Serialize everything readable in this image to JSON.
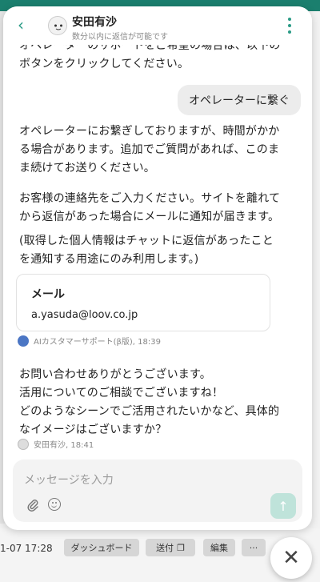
{
  "header": {
    "name": "安田有沙",
    "subtitle": "数分以内に返信が可能です"
  },
  "messages": {
    "partial_top_line1": "オペレーターのサポートをご希望の場合は、以下の",
    "partial_top_line2": "ボタンをクリックしてください。",
    "user_message": "オペレーターに繋ぐ",
    "bot_wait_line1": "オペレーターにお繋ぎしておりますが、時間がかか",
    "bot_wait_line2": "る場合があります。追加でご質問があれば、このま",
    "bot_wait_line3": "ま続けてお送りください。",
    "contact_line1": "お客様の連絡先をご入力ください。サイトを離れて",
    "contact_line2": "から返信があった場合にメールに通知が届きます。",
    "privacy_line1": "(取得した個人情報はチャットに返信があったこと",
    "privacy_line2": "を通知する用途にのみ利用します。)",
    "email_card": {
      "title": "メール",
      "value": "a.yasuda@loov.co.jp"
    },
    "ai_meta": "AIカスタマーサポート(β版), 18:39",
    "agent_line1": "お問い合わせありがとうございます。",
    "agent_line2": "活用についてのご相談でございますね！",
    "agent_line3": "どのようなシーンでご活用されたいかなど、具体的",
    "agent_line4": "なイメージはございますか？",
    "agent_meta": "安田有沙, 18:41"
  },
  "composer": {
    "placeholder": "メッセージを入力"
  },
  "background": {
    "date": "1-07 17:28",
    "chip_dashboard": "ダッシュボード",
    "chip_send": "送付",
    "chip_edit": "編集",
    "chip_more": "···"
  },
  "colors": {
    "accent": "#2a9b86",
    "send_disabled": "#bfe3da"
  },
  "icons": {
    "back": "chevron-left-icon",
    "menu": "vertical-dots-icon",
    "attach": "paperclip-icon",
    "emoji": "smiley-icon",
    "send": "arrow-up-icon",
    "close": "close-icon",
    "copy": "copy-icon"
  }
}
